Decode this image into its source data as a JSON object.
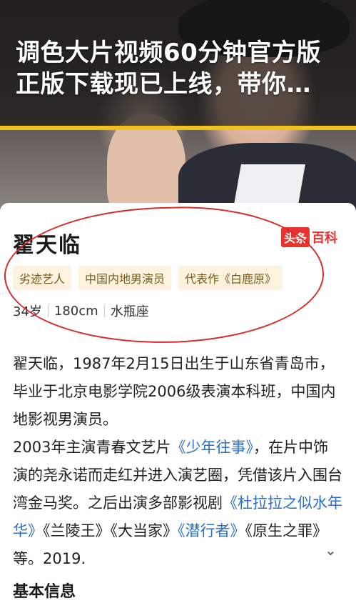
{
  "video": {
    "headline": "调色大片视频60分钟官方版正版下载现已上线，带你…"
  },
  "card": {
    "name": "翟天临",
    "brand_left": "头条",
    "brand_right": "百科",
    "tags": [
      "劣迹艺人",
      "中国内地男演员",
      "代表作《白鹿原》"
    ],
    "stats": [
      "34岁",
      "180cm",
      "水瓶座"
    ]
  },
  "bio": {
    "p1": "翟天临，1987年2月15日出生于山东省青岛市，毕业于北京电影学院2006级表演本科班，中国内地影视男演员。",
    "p2_a": "2003年主演青春文艺片",
    "p2_link1": "《少年往事》",
    "p2_b": "，在片中饰演的尧永诺而走红并进入演艺圈，凭借该片入围台湾金马奖。之后出演多部影视剧",
    "p2_link2": "《杜拉拉之似水年华》",
    "p2_c": "《兰陵王》《大当家》",
    "p2_link3": "《潜行者》",
    "p2_d": "《原生之罪》等。2019."
  },
  "section_title": "基本信息",
  "icons": {
    "expand": "chevron-down-icon"
  },
  "colors": {
    "accent_yellow": "#f2c21c",
    "brand_red": "#e8332f",
    "link_blue": "#2a6ec7",
    "annotation_red": "#d82a2a"
  }
}
